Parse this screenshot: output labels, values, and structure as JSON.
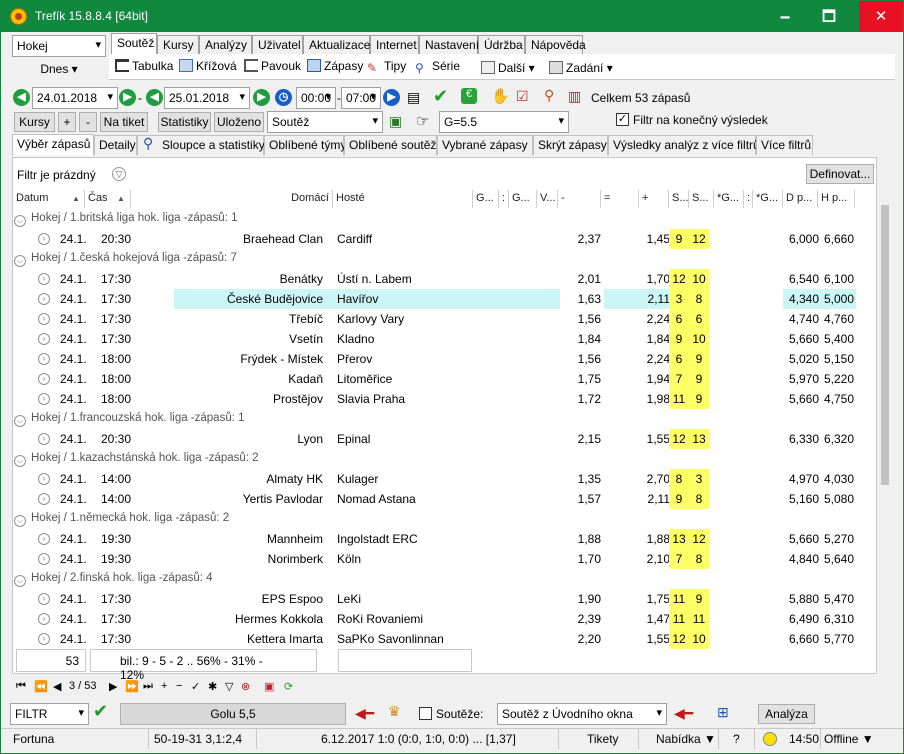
{
  "window": {
    "title": "Trefík 15.8.8.4 [64bit]",
    "minimize": "🗕",
    "maximize": "🗖",
    "close": "✕"
  },
  "sport_select": "Hokej",
  "today_label": "Dnes",
  "menu_tabs": [
    "Soutěž",
    "Kursy",
    "Analýzy",
    "Uživatel",
    "Aktualizace",
    "Internet",
    "Nastavení",
    "Údržba",
    "Nápověda"
  ],
  "toolbar": {
    "tabulka": "Tabulka",
    "krizova": "Křížová",
    "pavouk": "Pavouk",
    "zapasy": "Zápasy",
    "tipy": "Tipy",
    "serie": "Série",
    "dalsi": "Další",
    "zadani": "Zadání"
  },
  "dates": {
    "from": "24.01.2018",
    "to": "25.01.2018",
    "time_from": "00:00",
    "time_to": "07:00",
    "total": "Celkem 53 zápasů"
  },
  "row2": {
    "kursy": "Kursy",
    "plus": "+",
    "minus": "-",
    "na_tiket": "Na tiket",
    "statistiky": "Statistiky",
    "ulozeno": "Uloženo",
    "souteze": "Soutěž",
    "goly": "G=5.5",
    "filter_final": "Filtr na konečný výsledek"
  },
  "subtabs": [
    "Výběr zápasů",
    "Detaily",
    "Sloupce a statistiky",
    "Oblíbené týmy",
    "Oblíbené soutěže",
    "Vybrané zápasy",
    "Skrýt zápasy",
    "Výsledky analýz z více filtrů",
    "Více filtrů"
  ],
  "filter": {
    "status": "Filtr je prázdný",
    "define": "Definovat..."
  },
  "columns": [
    "Datum",
    "Čas",
    "Domácí",
    "Hosté",
    "G...",
    ":",
    "G...",
    "V...",
    "-",
    "=",
    "+",
    "S...",
    "S...",
    "*G...",
    ":",
    "*G...",
    "D p...",
    "H p..."
  ],
  "groups": [
    {
      "label": "Hokej / 1.britská liga hok. liga -zápasů: 1",
      "rows": [
        {
          "d": "24.1.",
          "t": "20:30",
          "h": "Braehead Clan",
          "a": "Cardiff",
          "o1": "2,37",
          "o2": "1,45",
          "s1": "9",
          "s2": "12",
          "dp": "6,000",
          "hp": "6,660"
        }
      ]
    },
    {
      "label": "Hokej / 1.česká hokejová liga -zápasů: 7",
      "rows": [
        {
          "d": "24.1.",
          "t": "17:30",
          "h": "Benátky",
          "a": "Ústí n. Labem",
          "o1": "2,01",
          "o2": "1,70",
          "s1": "12",
          "s2": "10",
          "dp": "6,540",
          "hp": "6,100"
        },
        {
          "d": "24.1.",
          "t": "17:30",
          "h": "České Budějovice",
          "a": "Havířov",
          "o1": "1,63",
          "o2": "2,11",
          "s1": "3",
          "s2": "8",
          "dp": "4,340",
          "hp": "5,000",
          "sel": true
        },
        {
          "d": "24.1.",
          "t": "17:30",
          "h": "Třebíč",
          "a": "Karlovy Vary",
          "o1": "1,56",
          "o2": "2,24",
          "s1": "6",
          "s2": "6",
          "dp": "4,740",
          "hp": "4,760"
        },
        {
          "d": "24.1.",
          "t": "17:30",
          "h": "Vsetín",
          "a": "Kladno",
          "o1": "1,84",
          "o2": "1,84",
          "s1": "9",
          "s2": "10",
          "dp": "5,660",
          "hp": "5,400"
        },
        {
          "d": "24.1.",
          "t": "18:00",
          "h": "Frýdek - Místek",
          "a": "Přerov",
          "o1": "1,56",
          "o2": "2,24",
          "s1": "6",
          "s2": "9",
          "dp": "5,020",
          "hp": "5,150"
        },
        {
          "d": "24.1.",
          "t": "18:00",
          "h": "Kadaň",
          "a": "Litoměřice",
          "o1": "1,75",
          "o2": "1,94",
          "s1": "7",
          "s2": "9",
          "dp": "5,970",
          "hp": "5,220"
        },
        {
          "d": "24.1.",
          "t": "18:00",
          "h": "Prostějov",
          "a": "Slavia Praha",
          "o1": "1,72",
          "o2": "1,98",
          "s1": "11",
          "s2": "9",
          "dp": "5,660",
          "hp": "4,750"
        }
      ]
    },
    {
      "label": "Hokej / 1.francouzská hok. liga -zápasů: 1",
      "rows": [
        {
          "d": "24.1.",
          "t": "20:30",
          "h": "Lyon",
          "a": "Epinal",
          "o1": "2,15",
          "o2": "1,55",
          "s1": "12",
          "s2": "13",
          "dp": "6,330",
          "hp": "6,320"
        }
      ]
    },
    {
      "label": "Hokej / 1.kazachstánská hok. liga -zápasů: 2",
      "rows": [
        {
          "d": "24.1.",
          "t": "14:00",
          "h": "Almaty HK",
          "a": "Kulager",
          "o1": "1,35",
          "o2": "2,70",
          "s1": "8",
          "s2": "3",
          "dp": "4,970",
          "hp": "4,030"
        },
        {
          "d": "24.1.",
          "t": "14:00",
          "h": "Yertis Pavlodar",
          "a": "Nomad Astana",
          "o1": "1,57",
          "o2": "2,11",
          "s1": "9",
          "s2": "8",
          "dp": "5,160",
          "hp": "5,080"
        }
      ]
    },
    {
      "label": "Hokej / 1.německá hok. liga -zápasů: 2",
      "rows": [
        {
          "d": "24.1.",
          "t": "19:30",
          "h": "Mannheim",
          "a": "Ingolstadt ERC",
          "o1": "1,88",
          "o2": "1,88",
          "s1": "13",
          "s2": "12",
          "dp": "5,660",
          "hp": "5,270"
        },
        {
          "d": "24.1.",
          "t": "19:30",
          "h": "Norimberk",
          "a": "Köln",
          "o1": "1,70",
          "o2": "2,10",
          "s1": "7",
          "s2": "8",
          "dp": "4,840",
          "hp": "5,640"
        }
      ]
    },
    {
      "label": "Hokej / 2.finská hok. liga -zápasů: 4",
      "rows": [
        {
          "d": "24.1.",
          "t": "17:30",
          "h": "EPS Espoo",
          "a": "LeKi",
          "o1": "1,90",
          "o2": "1,75",
          "s1": "11",
          "s2": "9",
          "dp": "5,880",
          "hp": "5,470"
        },
        {
          "d": "24.1.",
          "t": "17:30",
          "h": "Hermes Kokkola",
          "a": "RoKi Rovaniemi",
          "o1": "2,39",
          "o2": "1,47",
          "s1": "11",
          "s2": "11",
          "dp": "6,490",
          "hp": "6,310"
        },
        {
          "d": "24.1.",
          "t": "17:30",
          "h": "Kettera Imarta",
          "a": "SaPKo Savonlinnan",
          "o1": "2,20",
          "o2": "1,55",
          "s1": "12",
          "s2": "10",
          "dp": "6,660",
          "hp": "5,770"
        }
      ]
    }
  ],
  "footer": {
    "count": "53",
    "stats": "bil.: 9 - 5 - 2 .. 56% - 31% - 12%",
    "nav": "3 / 53"
  },
  "bottom": {
    "filtr": "FILTR",
    "golu": "Golu 5,5",
    "souteze": "Soutěže:",
    "soutez_from": "Soutěž z Úvodního okna",
    "analyza": "Analýza"
  },
  "status": {
    "provider": "Fortuna",
    "rec": "50-19-31  3,1:2,4",
    "last": "6.12.2017 1:0 (0:0, 1:0, 0:0) ... [1,37]",
    "tikety": "Tikety",
    "nabidka": "Nabídka ▼",
    "q": "?",
    "time": "14:50",
    "offline": "Offline ▼"
  }
}
